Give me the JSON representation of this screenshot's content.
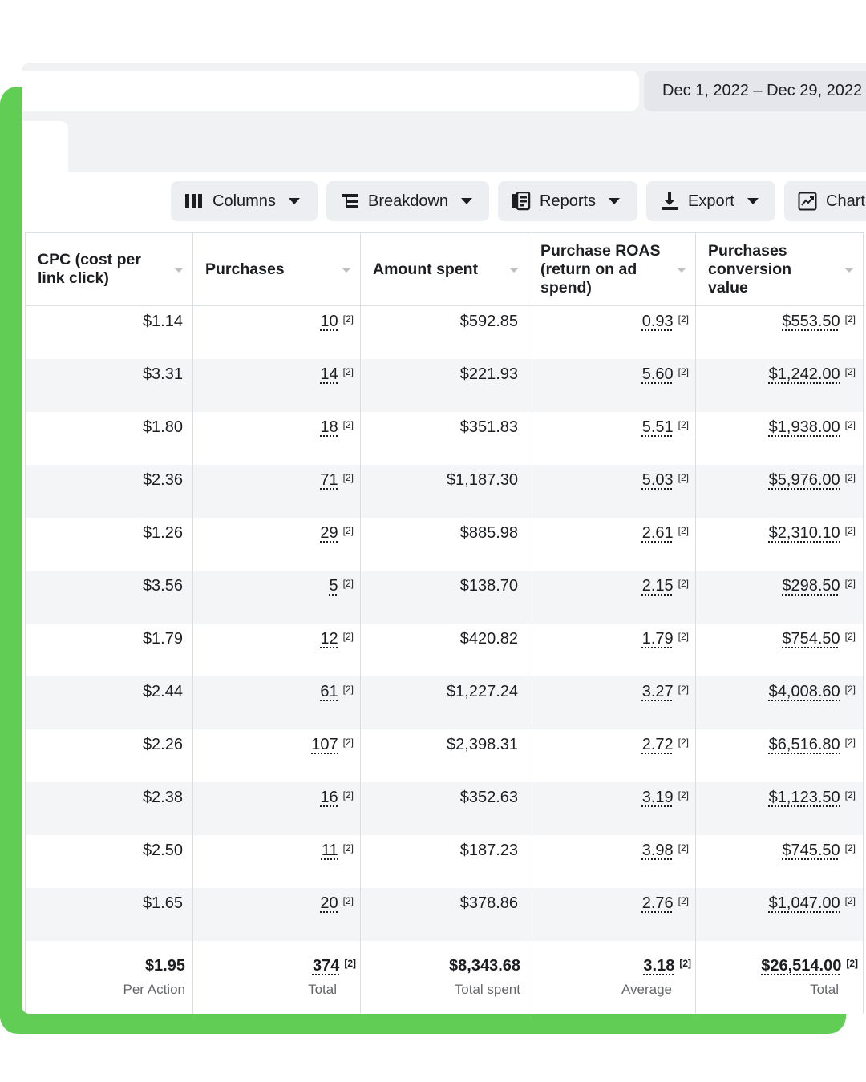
{
  "date_range": "Dec 1, 2022 – Dec 29, 2022",
  "toolbar": {
    "columns": "Columns",
    "breakdown": "Breakdown",
    "reports": "Reports",
    "export": "Export",
    "chart": "Chart"
  },
  "colors": {
    "accent": "#62cd55",
    "band": "#f1f2f4",
    "row_alt": "#f4f5f7",
    "border": "#dadde1"
  },
  "table": {
    "headers": [
      "CPC (cost per link click)",
      "Purchases",
      "Amount spent",
      "Purchase ROAS (return on ad spend)",
      "Purchases conversion value"
    ],
    "footnote_marker": "[2]",
    "rows": [
      [
        "$1.14",
        "10",
        "$592.85",
        "0.93",
        "$553.50"
      ],
      [
        "$3.31",
        "14",
        "$221.93",
        "5.60",
        "$1,242.00"
      ],
      [
        "$1.80",
        "18",
        "$351.83",
        "5.51",
        "$1,938.00"
      ],
      [
        "$2.36",
        "71",
        "$1,187.30",
        "5.03",
        "$5,976.00"
      ],
      [
        "$1.26",
        "29",
        "$885.98",
        "2.61",
        "$2,310.10"
      ],
      [
        "$3.56",
        "5",
        "$138.70",
        "2.15",
        "$298.50"
      ],
      [
        "$1.79",
        "12",
        "$420.82",
        "1.79",
        "$754.50"
      ],
      [
        "$2.44",
        "61",
        "$1,227.24",
        "3.27",
        "$4,008.60"
      ],
      [
        "$2.26",
        "107",
        "$2,398.31",
        "2.72",
        "$6,516.80"
      ],
      [
        "$2.38",
        "16",
        "$352.63",
        "3.19",
        "$1,123.50"
      ],
      [
        "$2.50",
        "11",
        "$187.23",
        "3.98",
        "$745.50"
      ],
      [
        "$1.65",
        "20",
        "$378.86",
        "2.76",
        "$1,047.00"
      ]
    ],
    "totals": [
      {
        "value": "$1.95",
        "label": "Per Action"
      },
      {
        "value": "374",
        "label": "Total"
      },
      {
        "value": "$8,343.68",
        "label": "Total spent"
      },
      {
        "value": "3.18",
        "label": "Average"
      },
      {
        "value": "$26,514.00",
        "label": "Total"
      }
    ]
  }
}
